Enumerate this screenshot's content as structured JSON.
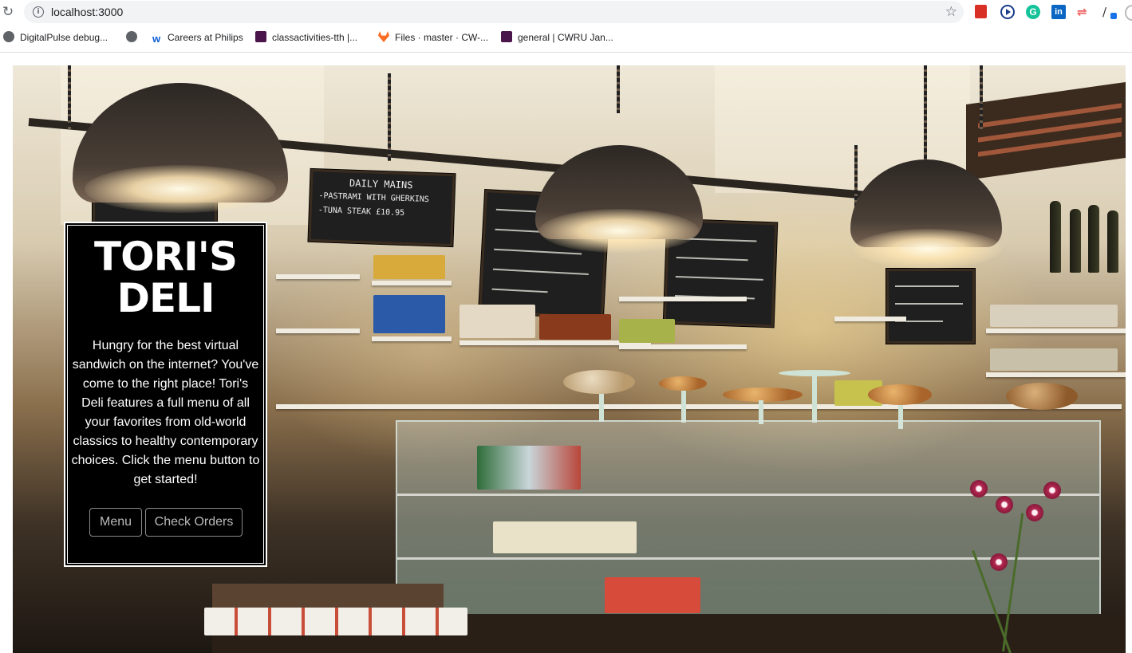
{
  "browser": {
    "url": "localhost:3000",
    "bookmarks": [
      {
        "label": "DigitalPulse debug...",
        "icon": "globe-icon"
      },
      {
        "label": "",
        "icon": "globe-icon"
      },
      {
        "label": "Careers at Philips",
        "icon": "philips-icon"
      },
      {
        "label": "classactivities-tth |...",
        "icon": "slack-icon"
      },
      {
        "label": "Files · master · CW-...",
        "icon": "gitlab-icon"
      },
      {
        "label": "general | CWRU Jan...",
        "icon": "slack-icon"
      }
    ],
    "extensions": [
      "red-extension-icon",
      "play-extension-icon",
      "grammarly-icon",
      "linkedin-icon",
      "arrows-extension-icon",
      "color-picker-icon",
      "profile-icon"
    ],
    "extension_labels": {
      "grammarly": "G",
      "linkedin": "in"
    }
  },
  "hero": {
    "background": "photo of a deli interior with pendant lamps, chalkboard menus, shelves and a glass display counter",
    "chalkboard_1": [
      "DAILY MAINS",
      "-PASTRAMI WITH GHERKINS",
      "-TUNA STEAK  £10.95"
    ]
  },
  "intro": {
    "title": "TORI'S DELI",
    "description": "Hungry for the best virtual sandwich on the internet? You've come to the right place! Tori's Deli features a full menu of all your favorites from old-world classics to healthy contemporary choices. Click the menu button to get started!",
    "menu_button": "Menu",
    "orders_button": "Check Orders"
  },
  "colors": {
    "card_background": "#000000",
    "card_border": "#ffffff",
    "button_border": "#8a8a8a",
    "button_text": "#b9b9b9"
  }
}
